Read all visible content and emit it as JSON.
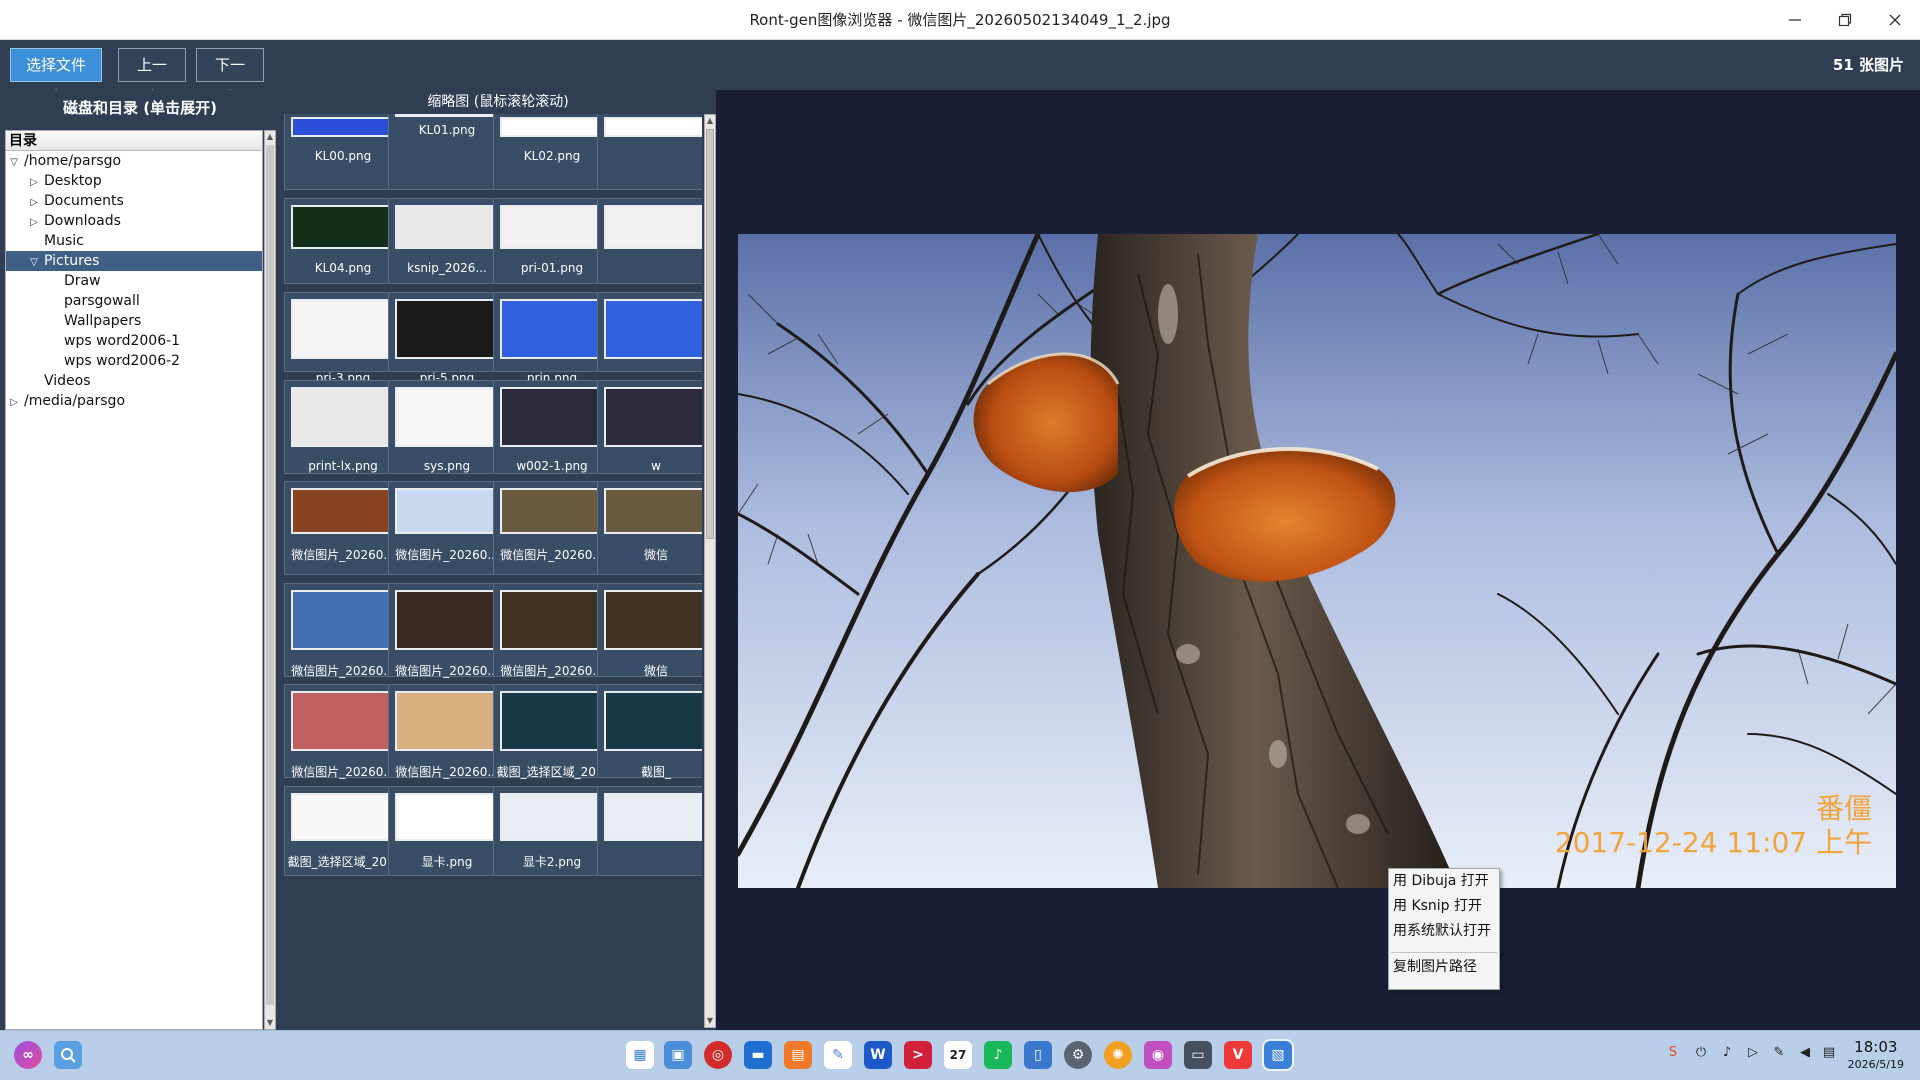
{
  "window": {
    "title": "Ront-gen图像浏览器 - 微信图片_20260502134049_1_2.jpg",
    "minimize_icon": "minimize-icon",
    "maximize_icon": "restore-icon",
    "close_icon": "close-icon"
  },
  "toolbar": {
    "choose_folder": "选择文件夹",
    "prev": "上一张",
    "next": "下一张",
    "count": "51 张图片"
  },
  "tree": {
    "panel_title": "磁盘和目录 (单击展开)",
    "header": "目录",
    "items": [
      {
        "label": "/home/parsgo",
        "depth": 0,
        "expander": "expanded",
        "selected": false
      },
      {
        "label": "Desktop",
        "depth": 1,
        "expander": "collapsed",
        "selected": false
      },
      {
        "label": "Documents",
        "depth": 1,
        "expander": "collapsed",
        "selected": false
      },
      {
        "label": "Downloads",
        "depth": 1,
        "expander": "collapsed",
        "selected": false
      },
      {
        "label": "Music",
        "depth": 1,
        "expander": "none",
        "selected": false
      },
      {
        "label": "Pictures",
        "depth": 1,
        "expander": "expanded",
        "selected": true
      },
      {
        "label": "Draw",
        "depth": 2,
        "expander": "none",
        "selected": false
      },
      {
        "label": "parsgowall",
        "depth": 2,
        "expander": "none",
        "selected": false
      },
      {
        "label": "Wallpapers",
        "depth": 2,
        "expander": "none",
        "selected": false
      },
      {
        "label": "wps word2006-1",
        "depth": 2,
        "expander": "none",
        "selected": false
      },
      {
        "label": "wps word2006-2",
        "depth": 2,
        "expander": "none",
        "selected": false
      },
      {
        "label": "Videos",
        "depth": 1,
        "expander": "none",
        "selected": false
      },
      {
        "label": "/media/parsgo",
        "depth": 0,
        "expander": "collapsed",
        "selected": false
      }
    ]
  },
  "thumbnails": {
    "panel_title": "缩略图 (鼠标滚轮滚动)",
    "rows": [
      [
        "KL00.png",
        "KL01.png",
        "KL02.png",
        ""
      ],
      [
        "KL04.png",
        "ksnip_2026...",
        "pri-01.png",
        ""
      ],
      [
        "pri-3.png",
        "pri-5.png",
        "prin.png",
        ""
      ],
      [
        "print-lx.png",
        "sys.png",
        "w002-1.png",
        "w"
      ],
      [
        "微信图片_20260...",
        "微信图片_20260...",
        "微信图片_20260...",
        "微信"
      ],
      [
        "微信图片_20260...",
        "微信图片_20260...",
        "微信图片_20260...",
        "微信"
      ],
      [
        "微信图片_20260...",
        "微信图片_20260...",
        "截图_选择区域_20...",
        "截图_"
      ],
      [
        "截图_选择区域_20...",
        "显卡.png",
        "显卡2.png",
        ""
      ]
    ]
  },
  "viewer": {
    "watermark_line1": "番僵",
    "watermark_line2": "2017-12-24 11:07 上午"
  },
  "context_menu": {
    "items": [
      "用 Dibuja 打开",
      "用 Ksnip 打开",
      "用系统默认打开"
    ],
    "copy_path": "复制图片路径"
  },
  "taskbar": {
    "time": "18:03",
    "date": "2026/5/19",
    "calendar_day": "27",
    "icons": [
      "launcher-icon",
      "search-icon",
      "app-grid-icon",
      "workspace-icon",
      "browser-icon",
      "file-manager-icon",
      "app-store-icon",
      "text-editor-icon",
      "wps-writer-icon",
      "terminal-icon",
      "calendar-icon",
      "music-icon",
      "tablet-icon",
      "settings-icon",
      "image-viewer-icon",
      "camera-icon",
      "printer-icon",
      "vivaldi-icon",
      "rontgen-viewer-icon"
    ]
  }
}
